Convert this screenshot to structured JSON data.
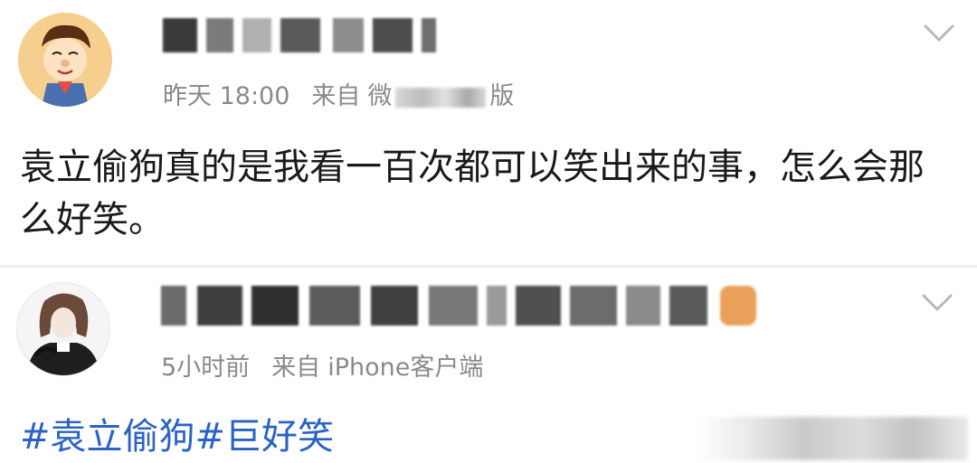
{
  "posts": [
    {
      "time": "昨天 18:00",
      "source_prefix": "来自",
      "source_partial": "微",
      "source_suffix": "版",
      "text": "袁立偷狗真的是我看一百次都可以笑出来的事，怎么会那么好笑。",
      "avatar_icon": "cartoon-boy-avatar-icon"
    },
    {
      "time": "5小时前",
      "source_prefix": "来自",
      "source_name": "iPhone客户端",
      "topics": [
        "#袁立偷狗",
        "#巨好笑"
      ],
      "avatar_icon": "sketch-girl-avatar-icon"
    }
  ],
  "colors": {
    "meta_gray": "#8a8a8a",
    "text": "#1a1a1a",
    "topic_blue": "#2a63c6",
    "divider": "#eeeeee"
  }
}
